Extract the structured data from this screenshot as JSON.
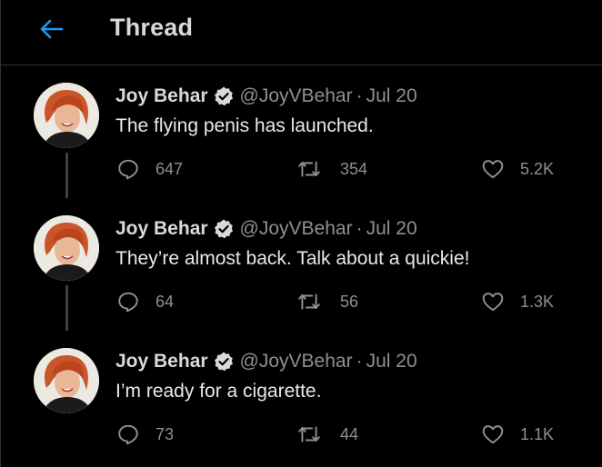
{
  "header": {
    "title": "Thread",
    "back_icon": "arrow-left-icon",
    "accent": "#1d9bf0"
  },
  "tweets": [
    {
      "name": "Joy Behar",
      "handle": "@JoyVBehar",
      "separator": "·",
      "date": "Jul 20",
      "text": "The flying penis has launched.",
      "replies": "647",
      "retweets": "354",
      "likes": "5.2K"
    },
    {
      "name": "Joy Behar",
      "handle": "@JoyVBehar",
      "separator": "·",
      "date": "Jul 20",
      "text": "They’re almost back. Talk about a quickie!",
      "replies": "64",
      "retweets": "56",
      "likes": "1.3K"
    },
    {
      "name": "Joy Behar",
      "handle": "@JoyVBehar",
      "separator": "·",
      "date": "Jul 20",
      "text": "I’m ready for a cigarette.",
      "replies": "73",
      "retweets": "44",
      "likes": "1.1K"
    }
  ],
  "icons": {
    "reply": "reply-icon",
    "retweet": "retweet-icon",
    "like": "heart-icon",
    "verified": "verified-badge-icon"
  }
}
